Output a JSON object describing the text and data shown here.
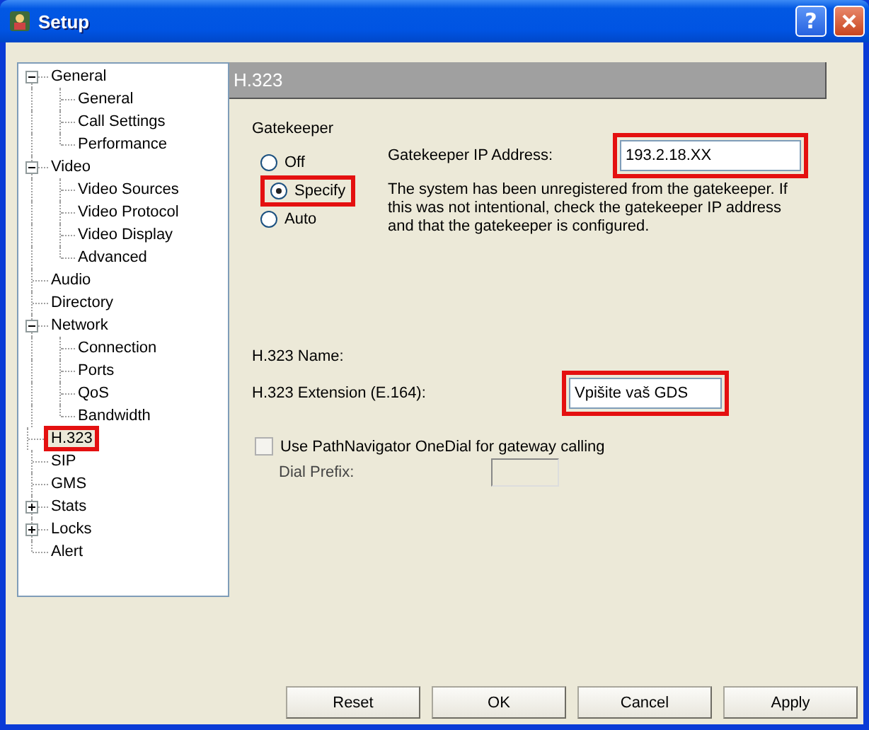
{
  "window": {
    "title": "Setup",
    "help_label": "?"
  },
  "tree": {
    "items": [
      {
        "label": "General",
        "expanded": true,
        "selected": false,
        "highlighted": false,
        "children": [
          {
            "label": "General",
            "selected": false,
            "highlighted": false
          },
          {
            "label": "Call Settings",
            "selected": false,
            "highlighted": false
          },
          {
            "label": "Performance",
            "selected": false,
            "highlighted": false
          }
        ]
      },
      {
        "label": "Video",
        "expanded": true,
        "selected": false,
        "highlighted": false,
        "children": [
          {
            "label": "Video Sources",
            "selected": false,
            "highlighted": false
          },
          {
            "label": "Video Protocol",
            "selected": false,
            "highlighted": false
          },
          {
            "label": "Video Display",
            "selected": false,
            "highlighted": false
          },
          {
            "label": "Advanced",
            "selected": false,
            "highlighted": false
          }
        ]
      },
      {
        "label": "Audio",
        "selected": false,
        "highlighted": false
      },
      {
        "label": "Directory",
        "selected": false,
        "highlighted": false
      },
      {
        "label": "Network",
        "expanded": true,
        "selected": false,
        "highlighted": false,
        "children": [
          {
            "label": "Connection",
            "selected": false,
            "highlighted": false
          },
          {
            "label": "Ports",
            "selected": false,
            "highlighted": false
          },
          {
            "label": "QoS",
            "selected": false,
            "highlighted": false
          },
          {
            "label": "Bandwidth",
            "selected": false,
            "highlighted": false
          }
        ]
      },
      {
        "label": "H.323",
        "selected": true,
        "highlighted": true
      },
      {
        "label": "SIP",
        "selected": false,
        "highlighted": false
      },
      {
        "label": "GMS",
        "selected": false,
        "highlighted": false
      },
      {
        "label": "Stats",
        "expanded": false,
        "selected": false,
        "highlighted": false
      },
      {
        "label": "Locks",
        "expanded": false,
        "selected": false,
        "highlighted": false
      },
      {
        "label": "Alert",
        "selected": false,
        "highlighted": false
      }
    ]
  },
  "panel": {
    "title": "H.323",
    "gatekeeper": {
      "label": "Gatekeeper",
      "options": [
        {
          "label": "Off",
          "selected": false,
          "highlighted": false
        },
        {
          "label": "Specify",
          "selected": true,
          "highlighted": true
        },
        {
          "label": "Auto",
          "selected": false,
          "highlighted": false
        }
      ],
      "ip_label": "Gatekeeper IP Address:",
      "ip_value": "193.2.18.XX",
      "ip_highlighted": true,
      "message": "The system has been unregistered from the gatekeeper. If this was not intentional, check the gatekeeper IP address and that the gatekeeper is configured."
    },
    "name_label": "H.323 Name:",
    "extension_label": "H.323 Extension (E.164):",
    "extension_value": "Vpišite vaš GDS",
    "extension_highlighted": true,
    "onedial": {
      "label": "Use PathNavigator OneDial for gateway calling",
      "checked": false
    },
    "dial_prefix": {
      "label": "Dial Prefix:",
      "disabled": true
    }
  },
  "buttons": [
    "Reset",
    "OK",
    "Cancel",
    "Apply"
  ]
}
